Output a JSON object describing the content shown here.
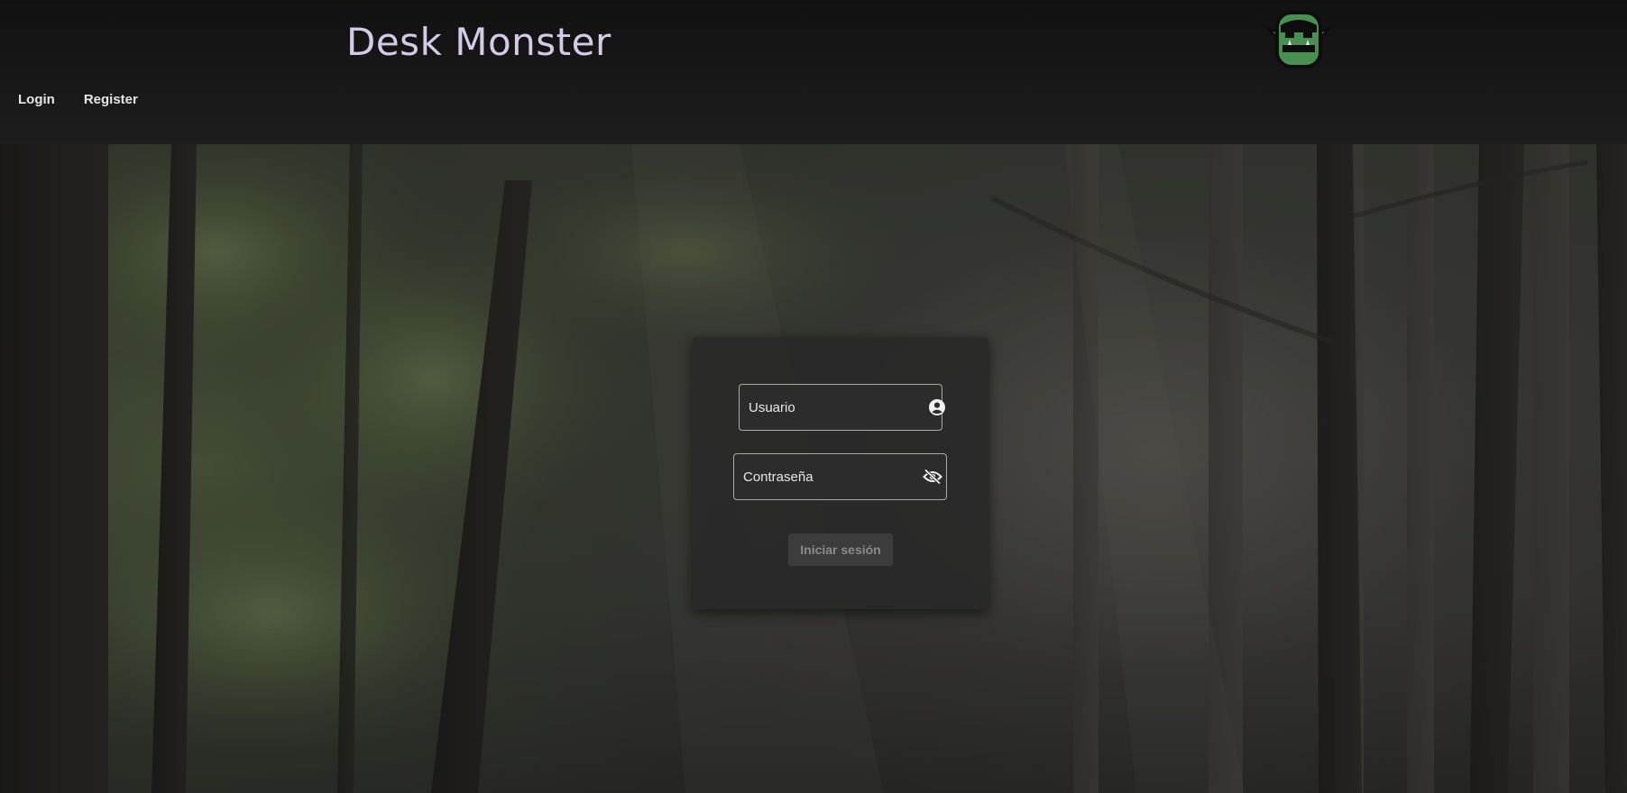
{
  "header": {
    "title": "Desk Monster",
    "logo_icon": "orc-monster-icon"
  },
  "nav": {
    "items": [
      {
        "label": "Login"
      },
      {
        "label": "Register"
      }
    ]
  },
  "login_form": {
    "username": {
      "placeholder": "Usuario",
      "value": "",
      "icon": "account-circle-icon"
    },
    "password": {
      "placeholder": "Contraseña",
      "value": "",
      "icon": "visibility-off-icon"
    },
    "submit_label": "Iniciar sesión"
  },
  "colors": {
    "header_bg": "#161616",
    "title": "#d4cce6",
    "logo_green": "#4a8f52",
    "card_bg": "#282828",
    "button_disabled": "#3c3c3c"
  }
}
